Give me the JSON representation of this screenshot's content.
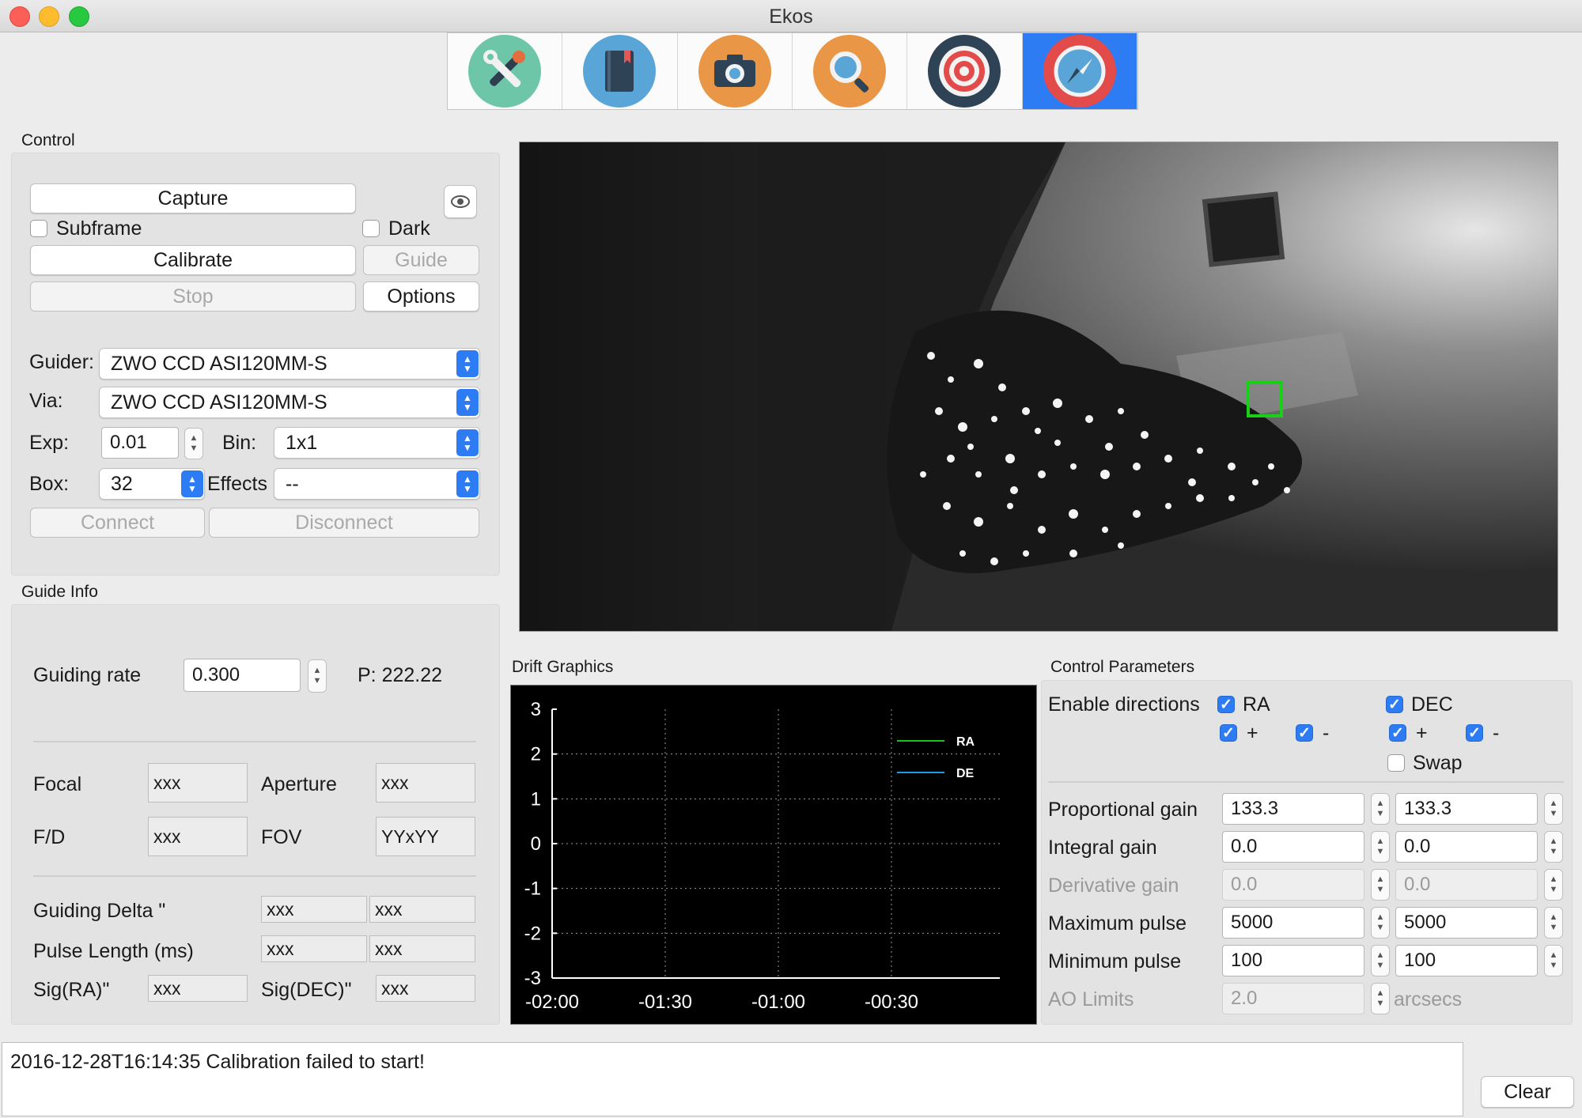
{
  "window": {
    "title": "Ekos"
  },
  "modules": [
    {
      "name": "setup-icon"
    },
    {
      "name": "scheduler-icon"
    },
    {
      "name": "capture-icon"
    },
    {
      "name": "focus-icon"
    },
    {
      "name": "align-icon"
    },
    {
      "name": "guide-icon",
      "active": true
    }
  ],
  "control": {
    "title": "Control",
    "capture": "Capture",
    "subframe": "Subframe",
    "dark": "Dark",
    "calibrate": "Calibrate",
    "guide": "Guide",
    "stop": "Stop",
    "options": "Options",
    "guider_label": "Guider:",
    "guider_value": "ZWO CCD ASI120MM-S",
    "via_label": "Via:",
    "via_value": "ZWO CCD ASI120MM-S",
    "exp_label": "Exp:",
    "exp_value": "0.01",
    "bin_label": "Bin:",
    "bin_value": "1x1",
    "box_label": "Box:",
    "box_value": "32",
    "effects_label": "Effects",
    "effects_value": "--",
    "connect": "Connect",
    "disconnect": "Disconnect"
  },
  "guide_info": {
    "title": "Guide Info",
    "rate_label": "Guiding rate",
    "rate_value": "0.300",
    "p_value": "P: 222.22",
    "focal_label": "Focal",
    "focal_value": "xxx",
    "aperture_label": "Aperture",
    "aperture_value": "xxx",
    "fd_label": "F/D",
    "fd_value": "xxx",
    "fov_label": "FOV",
    "fov_value": "YYxYY",
    "delta_label": "Guiding Delta \"",
    "delta_ra": "xxx",
    "delta_dec": "xxx",
    "pulse_label": "Pulse Length (ms)",
    "pulse_ra": "xxx",
    "pulse_dec": "xxx",
    "sigra_label": "Sig(RA)\"",
    "sigra_value": "xxx",
    "sigdec_label": "Sig(DEC)\"",
    "sigdec_value": "xxx"
  },
  "drift": {
    "title": "Drift Graphics",
    "chart_data": {
      "type": "line",
      "x_ticks": [
        "-02:00",
        "-01:30",
        "-01:00",
        "-00:30"
      ],
      "y_ticks": [
        "3",
        "2",
        "1",
        "0",
        "-1",
        "-2",
        "-3"
      ],
      "ylim": [
        -3,
        3
      ],
      "series": [
        {
          "name": "RA",
          "color": "#19c219",
          "values": []
        },
        {
          "name": "DE",
          "color": "#1e9be6",
          "values": []
        }
      ],
      "background": "#000000",
      "grid": "dotted"
    }
  },
  "params": {
    "title": "Control Parameters",
    "enable_label": "Enable directions",
    "ra": "RA",
    "dec": "DEC",
    "plus": "+",
    "minus": "-",
    "swap": "Swap",
    "rows": [
      {
        "label": "Proportional gain",
        "ra": "133.3",
        "dec": "133.3",
        "enabled": true
      },
      {
        "label": "Integral gain",
        "ra": "0.0",
        "dec": "0.0",
        "enabled": true
      },
      {
        "label": "Derivative gain",
        "ra": "0.0",
        "dec": "0.0",
        "enabled": false
      },
      {
        "label": "Maximum pulse",
        "ra": "5000",
        "dec": "5000",
        "enabled": true
      },
      {
        "label": "Minimum pulse",
        "ra": "100",
        "dec": "100",
        "enabled": true
      }
    ],
    "ao_label": "AO Limits",
    "ao_value": "2.0",
    "ao_unit": "arcsecs"
  },
  "log": {
    "text": "2016-12-28T16:14:35 Calibration failed to start!",
    "clear": "Clear"
  }
}
